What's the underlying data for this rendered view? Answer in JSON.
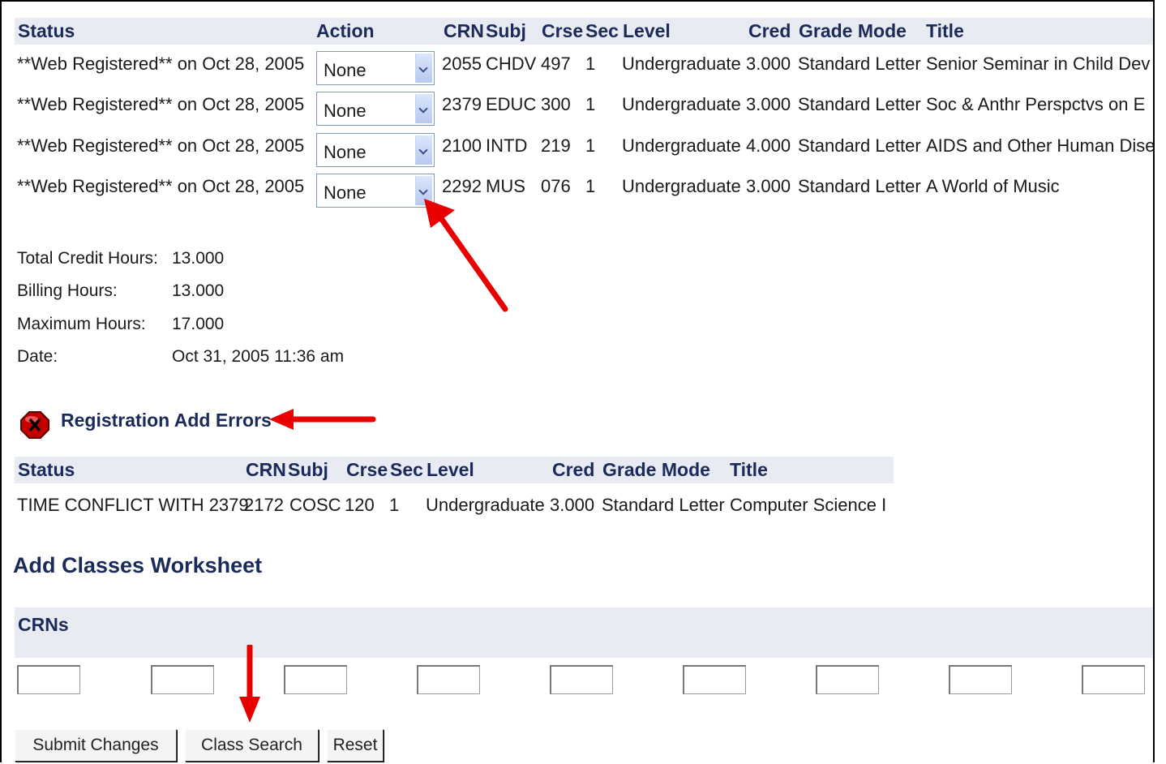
{
  "registration_table": {
    "headers": [
      "Status",
      "Action",
      "CRN",
      "Subj",
      "Crse",
      "Sec",
      "Level",
      "Cred",
      "Grade Mode",
      "Title"
    ],
    "rows": [
      {
        "status": "**Web Registered** on Oct 28, 2005",
        "action": "None",
        "crn": "2055",
        "subj": "CHDV",
        "crse": "497",
        "sec": "1",
        "level": "Undergraduate",
        "cred": "3.000",
        "grade_mode": "Standard Letter",
        "title": "Senior Seminar in Child Dev"
      },
      {
        "status": "**Web Registered** on Oct 28, 2005",
        "action": "None",
        "crn": "2379",
        "subj": "EDUC",
        "crse": "300",
        "sec": "1",
        "level": "Undergraduate",
        "cred": "3.000",
        "grade_mode": "Standard Letter",
        "title": "Soc & Anthr Perspctvs on E"
      },
      {
        "status": "**Web Registered** on Oct 28, 2005",
        "action": "None",
        "crn": "2100",
        "subj": "INTD",
        "crse": "219",
        "sec": "1",
        "level": "Undergraduate",
        "cred": "4.000",
        "grade_mode": "Standard Letter",
        "title": "AIDS and Other Human Dise"
      },
      {
        "status": "**Web Registered** on Oct 28, 2005",
        "action": "None",
        "crn": "2292",
        "subj": "MUS",
        "crse": "076",
        "sec": "1",
        "level": "Undergraduate",
        "cred": "3.000",
        "grade_mode": "Standard Letter",
        "title": "A World of Music"
      }
    ]
  },
  "summary": {
    "total_credit_label": "Total Credit Hours:",
    "total_credit_value": "13.000",
    "billing_label": "Billing Hours:",
    "billing_value": "13.000",
    "maximum_label": "Maximum Hours:",
    "maximum_value": "17.000",
    "date_label": "Date:",
    "date_value": "Oct 31, 2005 11:36 am"
  },
  "errors": {
    "title": "Registration Add Errors",
    "headers": [
      "Status",
      "CRN",
      "Subj",
      "Crse",
      "Sec",
      "Level",
      "Cred",
      "Grade Mode",
      "Title"
    ],
    "rows": [
      {
        "status": "TIME CONFLICT WITH 2379",
        "crn": "2172",
        "subj": "COSC",
        "crse": "120",
        "sec": "1",
        "level": "Undergraduate",
        "cred": "3.000",
        "grade_mode": "Standard Letter",
        "title": "Computer Science I"
      }
    ]
  },
  "worksheet": {
    "title": "Add Classes Worksheet",
    "crns_header": "CRNs",
    "crn_inputs": [
      "",
      "",
      "",
      "",
      "",
      "",
      "",
      "",
      ""
    ]
  },
  "buttons": {
    "submit": "Submit Changes",
    "class_search": "Class Search",
    "reset": "Reset"
  },
  "colors": {
    "header_bg": "#e8ebf2",
    "header_text": "#1a2a5a",
    "arrow": "#e80000",
    "error_icon": "#cc0000"
  }
}
